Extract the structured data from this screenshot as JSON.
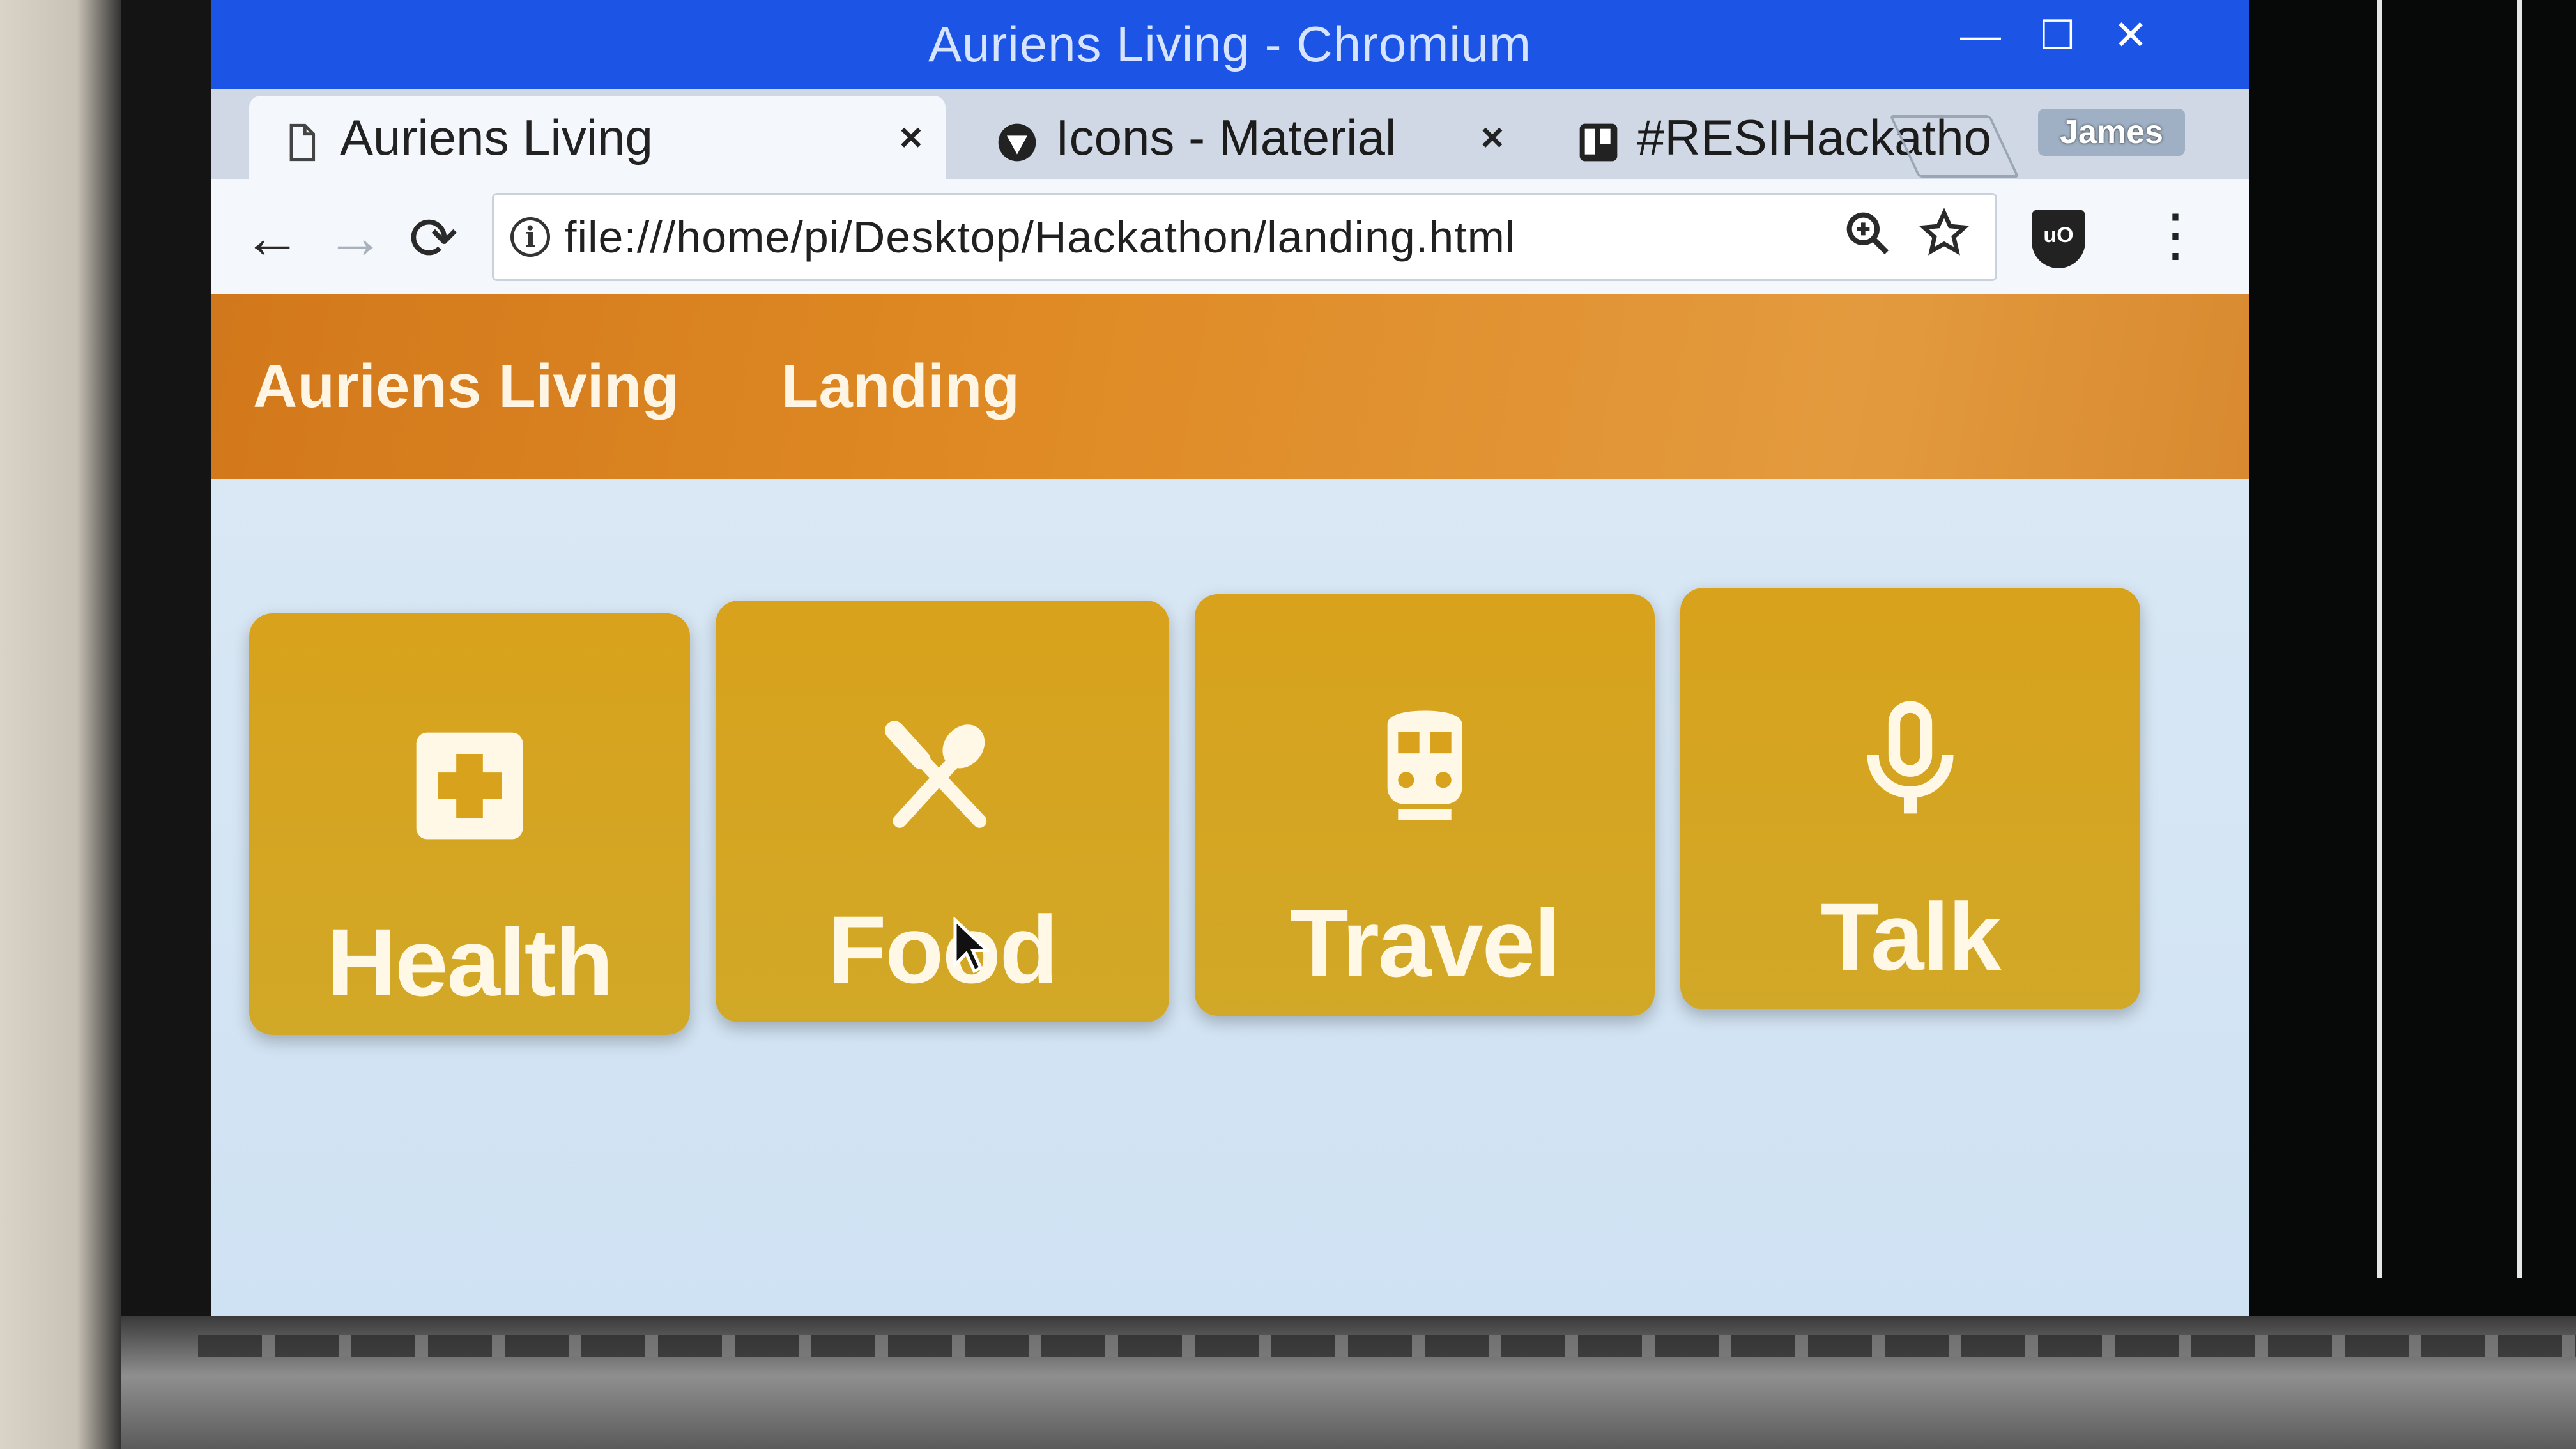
{
  "window": {
    "title": "Auriens Living - Chromium",
    "controls": {
      "minimize": "—",
      "maximize": "☐",
      "close": "✕"
    }
  },
  "tabs": [
    {
      "label": "Auriens Living",
      "close": "×",
      "active": true,
      "icon": "page-icon"
    },
    {
      "label": "Icons - Material",
      "close": "×",
      "active": false,
      "icon": "material-icon"
    },
    {
      "label": "#RESIHackatho",
      "close": "×",
      "active": false,
      "icon": "trello-icon"
    }
  ],
  "profile": {
    "name": "James"
  },
  "toolbar": {
    "back": "←",
    "forward": "→",
    "reload": "⟳",
    "url": "file:///home/pi/Desktop/Hackathon/landing.html",
    "info_icon": "i",
    "zoom_icon": "zoom-icon",
    "star_icon": "star-icon",
    "extension_badge": "uO",
    "menu": "⋮"
  },
  "app_nav": {
    "brand": "Auriens Living",
    "link": "Landing"
  },
  "tiles": [
    {
      "label": "Health",
      "icon": "health-cross-icon"
    },
    {
      "label": "Food",
      "icon": "restaurant-icon"
    },
    {
      "label": "Travel",
      "icon": "train-icon"
    },
    {
      "label": "Talk",
      "icon": "microphone-icon"
    }
  ],
  "colors": {
    "titlebar": "#1c55e6",
    "nav_orange": "#d2781c",
    "tile_gold": "#d8a21c",
    "page_bg": "#dce9f5"
  }
}
